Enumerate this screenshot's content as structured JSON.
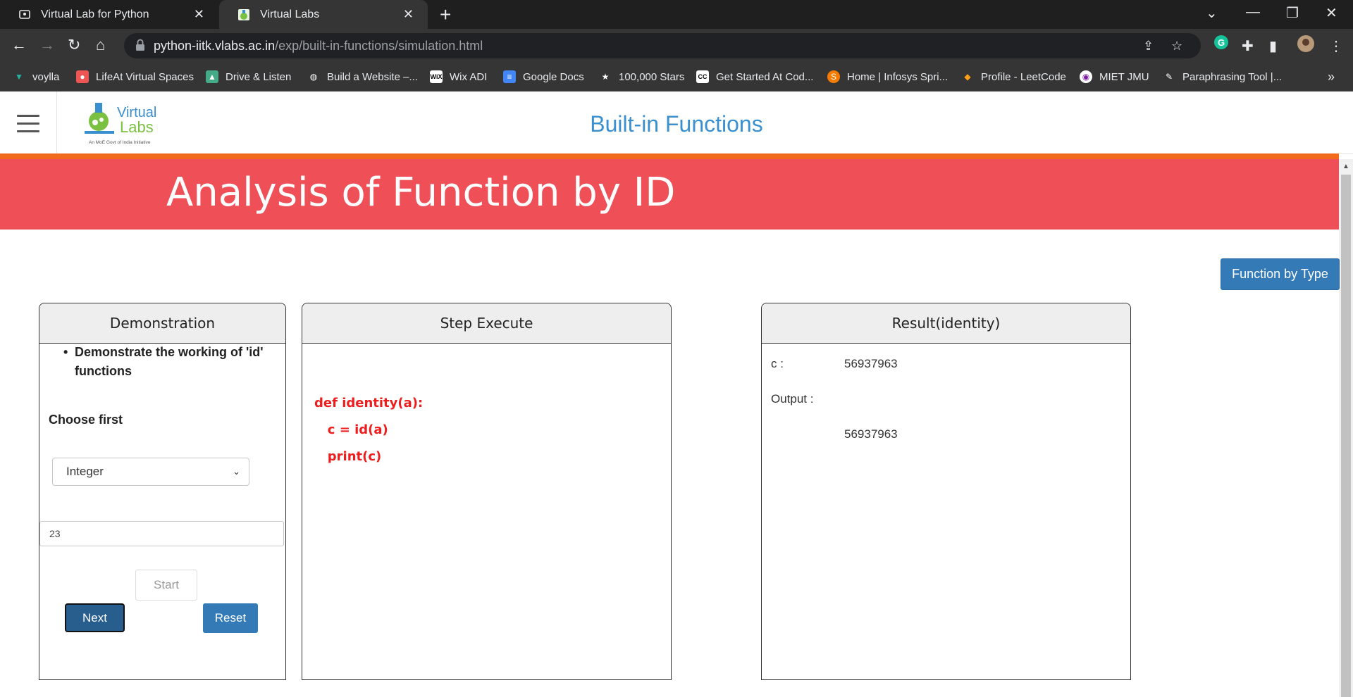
{
  "browser": {
    "tabs": [
      {
        "title": "Virtual Lab for Python"
      },
      {
        "title": "Virtual Labs"
      }
    ],
    "url_host": "python-iitk.vlabs.ac.in",
    "url_path": "/exp/built-in-functions/simulation.html",
    "bookmarks": [
      {
        "label": "voylla"
      },
      {
        "label": "LifeAt Virtual Spaces"
      },
      {
        "label": "Drive & Listen"
      },
      {
        "label": "Build a Website –..."
      },
      {
        "label": "Wix ADI"
      },
      {
        "label": "Google Docs"
      },
      {
        "label": "100,000 Stars"
      },
      {
        "label": "Get Started At Cod..."
      },
      {
        "label": "Home | Infosys Spri..."
      },
      {
        "label": "Profile - LeetCode"
      },
      {
        "label": "MIET JMU"
      },
      {
        "label": "Paraphrasing Tool |..."
      }
    ]
  },
  "header": {
    "logo_text_top": "Virtual",
    "logo_text_bottom": "Labs",
    "logo_tagline": "An MoE Govt of India Initiative",
    "title": "Built-in Functions"
  },
  "banner": {
    "title": "Analysis of Function by ID"
  },
  "function_by_type_label": "Function by Type",
  "demonstration": {
    "header": "Demonstration",
    "description": "Demonstrate the working of 'id' functions",
    "choose_label": "Choose first",
    "selected_type": "Integer",
    "input_value": "23",
    "start_label": "Start",
    "next_label": "Next",
    "reset_label": "Reset"
  },
  "step_execute": {
    "header": "Step Execute",
    "code_lines": [
      "def identity(a):",
      "   c = id(a)",
      "   print(c)"
    ]
  },
  "result": {
    "header": "Result(identity)",
    "c_label": "c :",
    "c_value": "56937963",
    "output_label": "Output :",
    "output_value": "56937963"
  }
}
